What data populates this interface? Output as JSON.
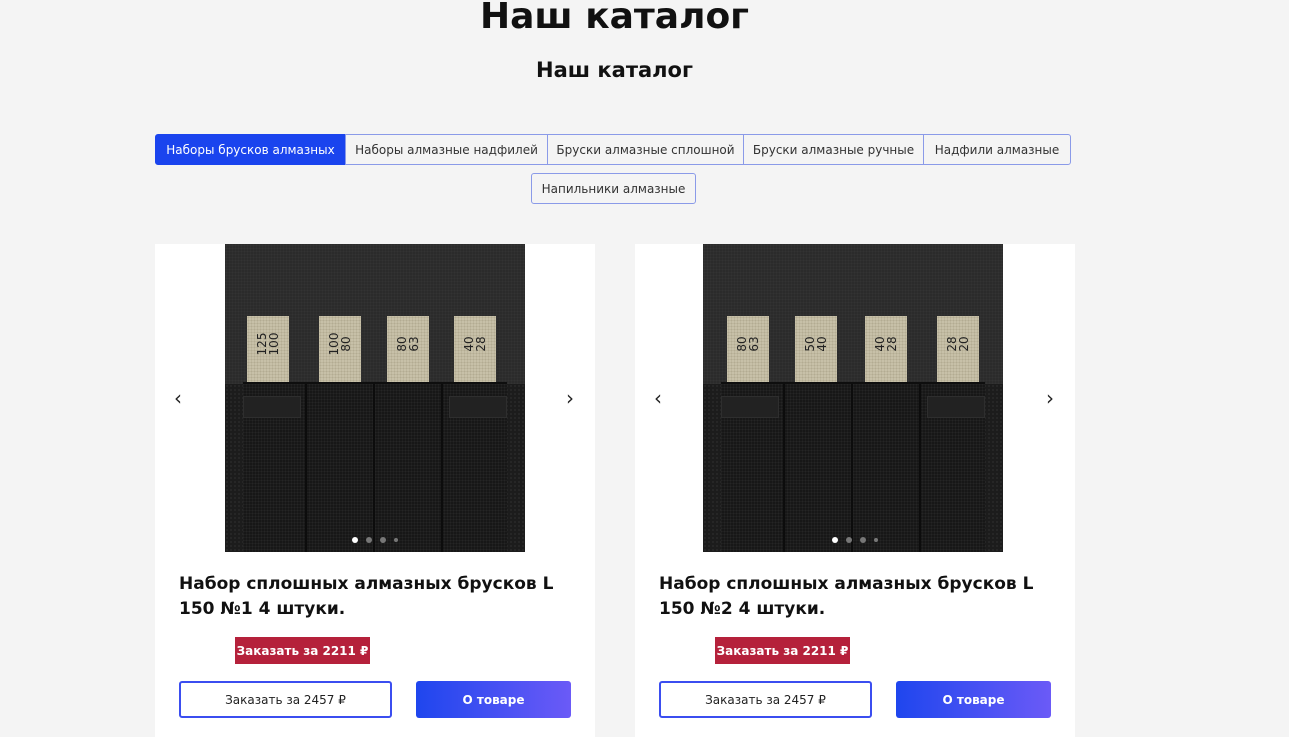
{
  "page": {
    "title": "Наш каталог",
    "subtitle": "Наш каталог"
  },
  "tabs": [
    {
      "label": "Наборы брусков алмазных",
      "active": true
    },
    {
      "label": "Наборы алмазные надфилей",
      "active": false
    },
    {
      "label": "Бруски алмазные сплошной",
      "active": false
    },
    {
      "label": "Бруски алмазные  ручные",
      "active": false
    },
    {
      "label": "Надфили алмазные",
      "active": false
    },
    {
      "label": "Напильники алмазные",
      "active": false
    }
  ],
  "products": [
    {
      "name": "Набор сплошных алмазных брусков L 150 №1 4 штуки.",
      "stone_labels": [
        "125\n100",
        "100\n80",
        "80\n63",
        "40\n28"
      ],
      "promo_label": "Заказать за 2211 ₽",
      "order_label": "Заказать за 2457 ₽",
      "details_label": "О товаре",
      "slides_total": 4,
      "active_slide": 1
    },
    {
      "name": "Набор сплошных алмазных брусков L 150 №2 4 штуки.",
      "stone_labels": [
        "80\n63",
        "50\n40",
        "40\n28",
        "28\n20"
      ],
      "promo_label": "Заказать за 2211 ₽",
      "order_label": "Заказать за 2457 ₽",
      "details_label": "О товаре",
      "slides_total": 4,
      "active_slide": 1
    }
  ],
  "icons": {
    "prev": "chevron-left-icon",
    "next": "chevron-right-icon"
  },
  "colors": {
    "accent": "#1a44ee",
    "promo": "#b5213b",
    "button_gradient_end": "#6b5af7"
  }
}
